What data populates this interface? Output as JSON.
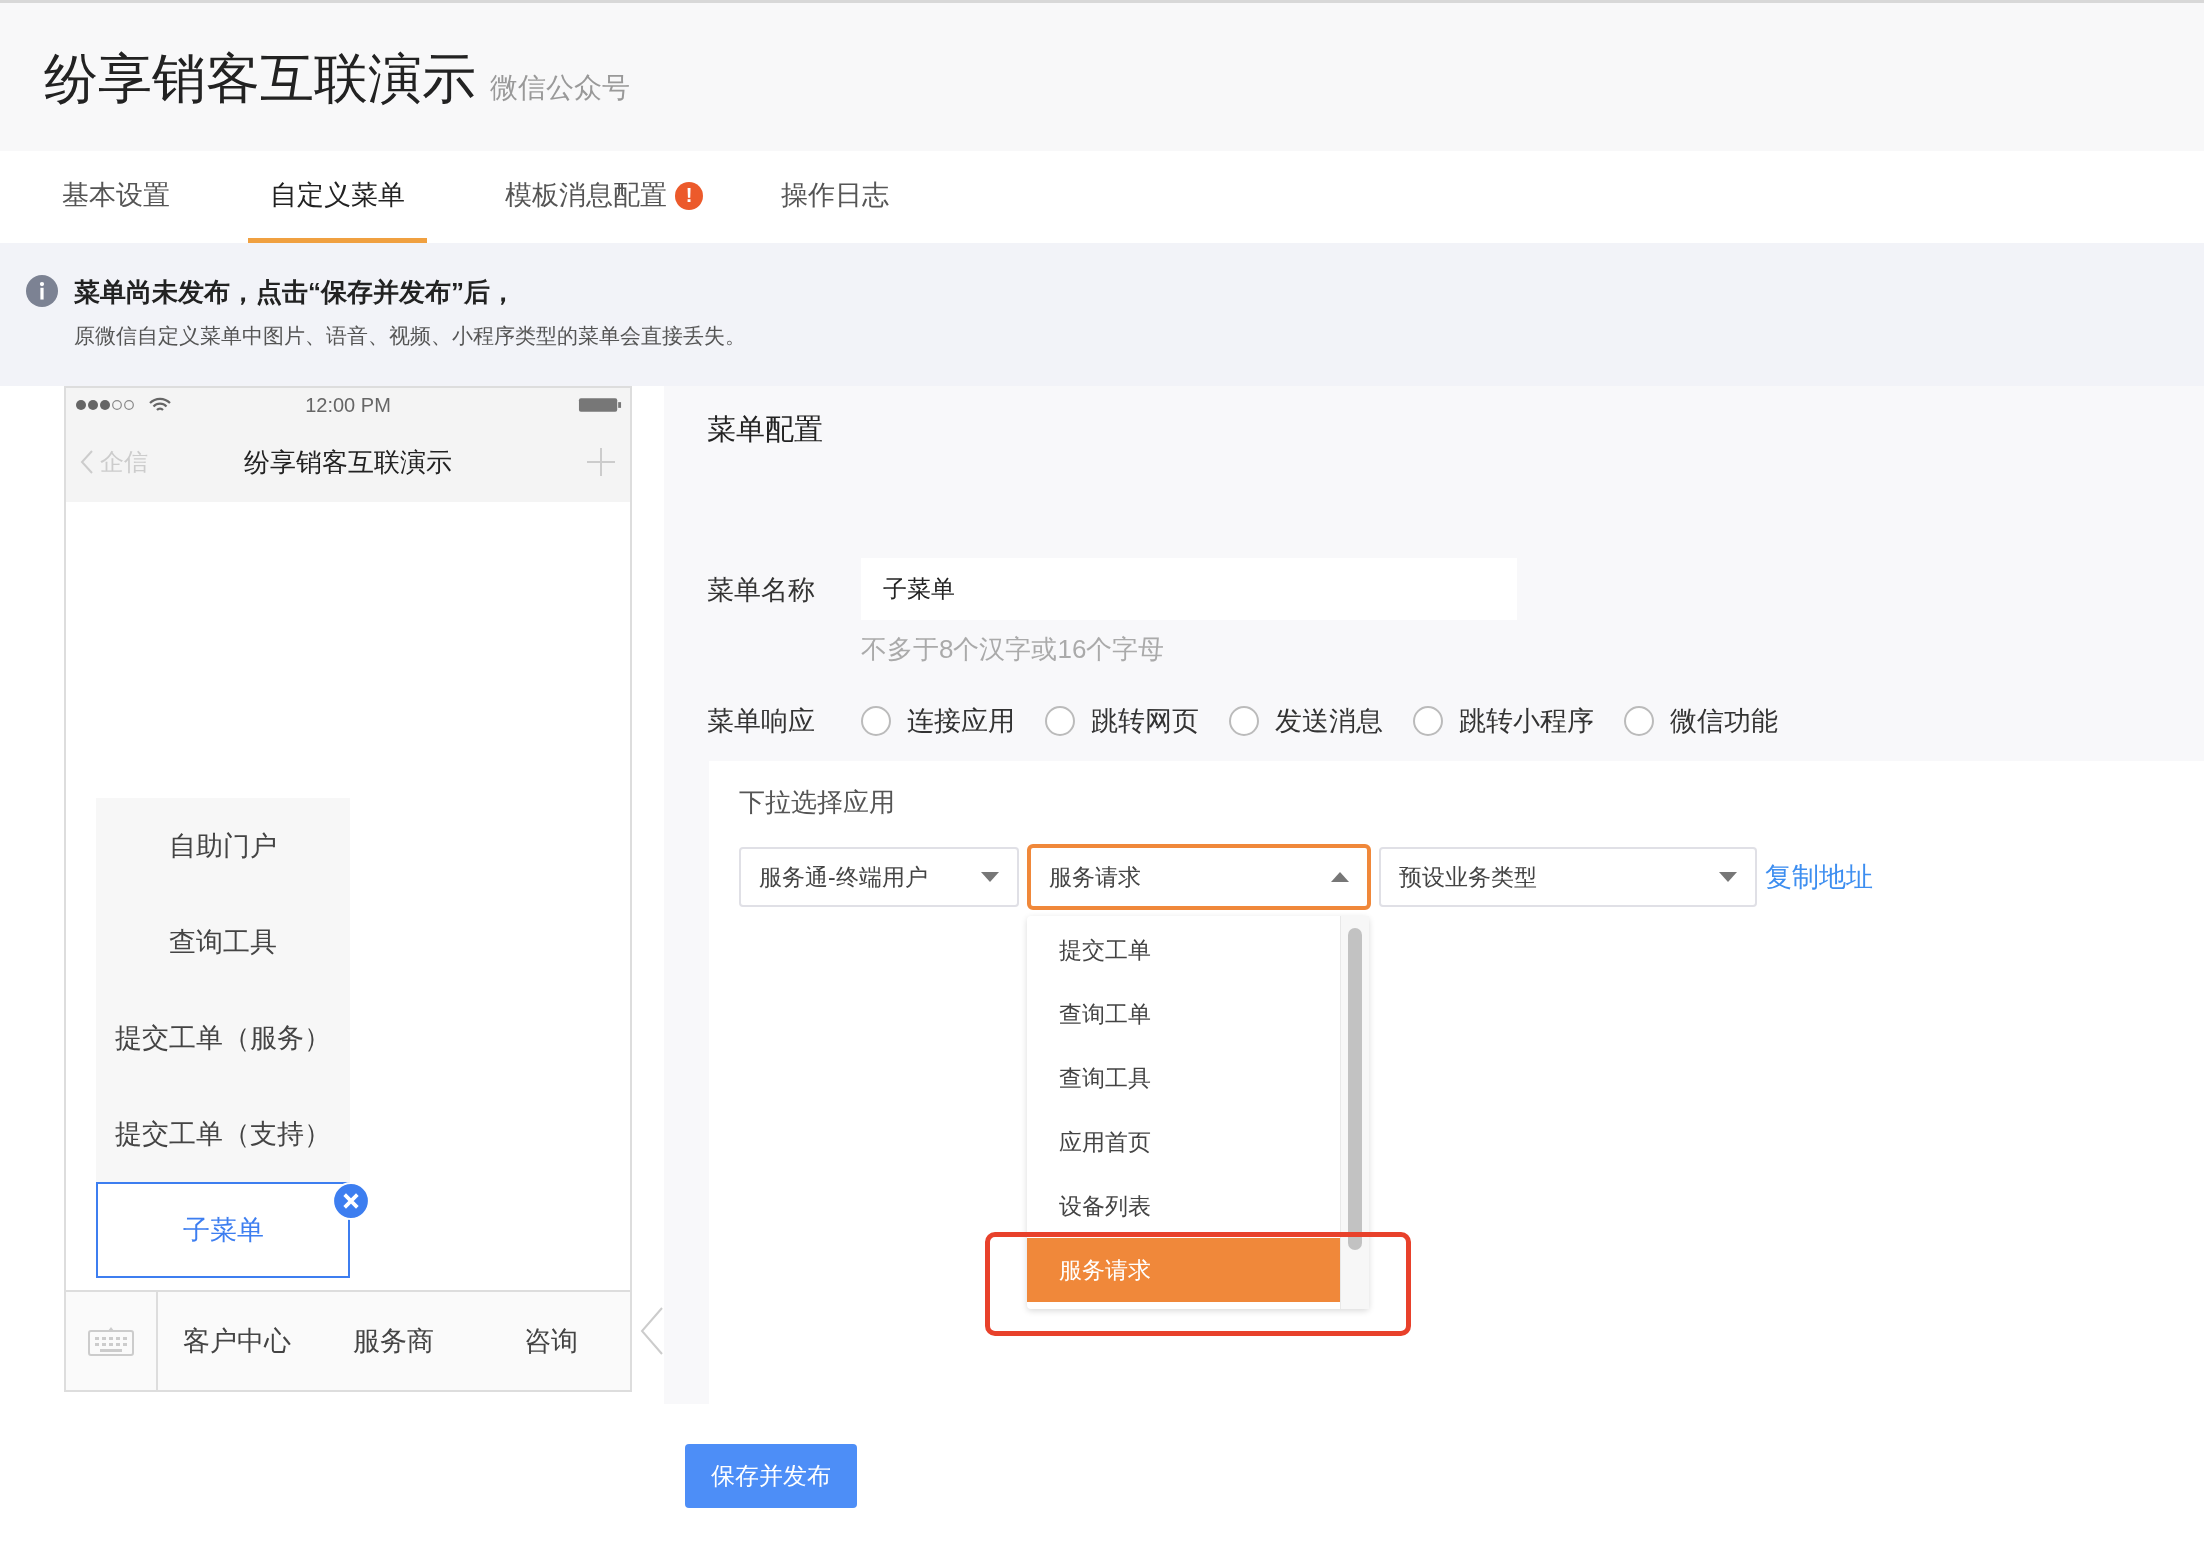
{
  "header": {
    "title": "纷享销客互联演示",
    "subtitle": "微信公众号"
  },
  "tabs": [
    {
      "label": "基本设置",
      "selected": false
    },
    {
      "label": "自定义菜单",
      "selected": true
    },
    {
      "label": "模板消息配置",
      "selected": false,
      "badge": "!"
    },
    {
      "label": "操作日志",
      "selected": false
    }
  ],
  "notice": {
    "title": "菜单尚未发布，点击“保存并发布”后，",
    "body": "原微信自定义菜单中图片、语音、视频、小程序类型的菜单会直接丢失。"
  },
  "phone": {
    "time": "12:00 PM",
    "back_label": "企信",
    "title": "纷享销客互联演示",
    "submenu": [
      {
        "label": "自助门户",
        "selected": false
      },
      {
        "label": "查询工具",
        "selected": false
      },
      {
        "label": "提交工单（服务）",
        "selected": false
      },
      {
        "label": "提交工单（支持）",
        "selected": false
      },
      {
        "label": "子菜单",
        "selected": true
      }
    ],
    "menu": [
      "客户中心",
      "服务商",
      "咨询"
    ]
  },
  "config": {
    "heading": "菜单配置",
    "name_label": "菜单名称",
    "name_value": "子菜单",
    "name_hint": "不多于8个汉字或16个字母",
    "response_label": "菜单响应",
    "response_options": [
      {
        "label": "连接应用",
        "selected": false
      },
      {
        "label": "跳转网页",
        "selected": false
      },
      {
        "label": "发送消息",
        "selected": false
      },
      {
        "label": "跳转小程序",
        "selected": false
      },
      {
        "label": "微信功能",
        "selected": false
      }
    ],
    "app_label": "下拉选择应用",
    "selects": [
      {
        "value": "服务通-终端用户",
        "open": false
      },
      {
        "value": "服务请求",
        "open": true
      },
      {
        "value": "预设业务类型",
        "open": false
      }
    ],
    "copy_link": "复制地址",
    "dropdown_options": [
      {
        "label": "提交工单",
        "selected": false
      },
      {
        "label": "查询工单",
        "selected": false
      },
      {
        "label": "查询工具",
        "selected": false
      },
      {
        "label": "应用首页",
        "selected": false
      },
      {
        "label": "设备列表",
        "selected": false
      },
      {
        "label": "服务请求",
        "selected": true
      }
    ]
  },
  "save_button": "保存并发布"
}
